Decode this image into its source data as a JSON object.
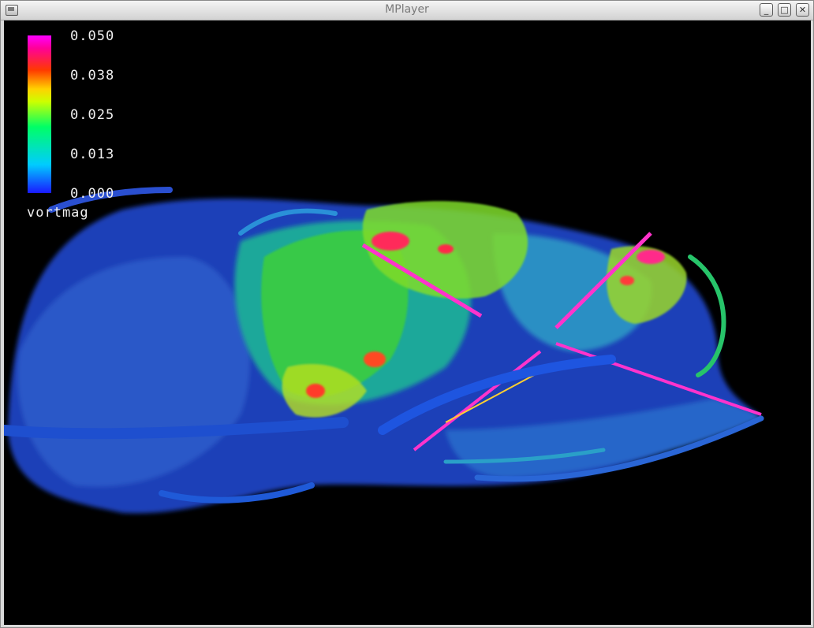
{
  "window": {
    "title": "MPlayer",
    "buttons": {
      "minimize": "_",
      "maximize": "□",
      "close": "✕"
    }
  },
  "legend": {
    "ticks": [
      "0.050",
      "0.038",
      "0.025",
      "0.013",
      "0.000"
    ],
    "variable": "vortmag",
    "range": [
      0.0,
      0.05
    ],
    "colors": [
      "#1a1aff",
      "#00ccff",
      "#00ff66",
      "#ccff00",
      "#ffd200",
      "#ff3a00",
      "#ff0099",
      "#ff00ff"
    ]
  },
  "icons": {
    "app": "mplayer-app-icon"
  }
}
